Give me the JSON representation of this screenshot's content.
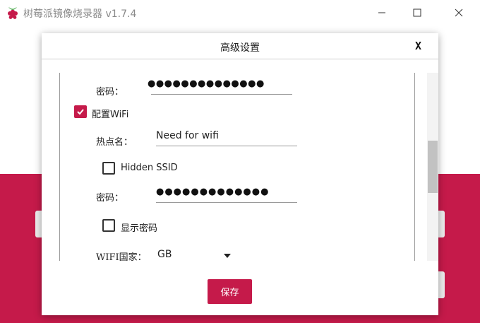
{
  "window": {
    "title": "树莓派镜像烧录器 v1.7.4",
    "minimize_icon": "minimize-icon",
    "maximize_icon": "maximize-icon",
    "close_icon": "close-icon"
  },
  "colors": {
    "brand": "#c51a4a",
    "background": "#ffffff"
  },
  "dialog": {
    "title": "高级设置",
    "close_label": "X",
    "ssh_password": {
      "label": "密码：",
      "value": "●●●●●●●●●●●●●●"
    },
    "configure_wifi": {
      "label": "配置WiFi",
      "checked": true
    },
    "ssid": {
      "label": "热点名：",
      "value": "Need for wifi"
    },
    "hidden_ssid": {
      "label": "Hidden SSID",
      "checked": false
    },
    "wifi_password": {
      "label": "密码：",
      "value": "●●●●●●●●●●●●●"
    },
    "show_password": {
      "label": "显示密码",
      "checked": false
    },
    "wifi_country": {
      "label": "WIFI国家：",
      "value": "GB"
    },
    "save_label": "保存"
  }
}
